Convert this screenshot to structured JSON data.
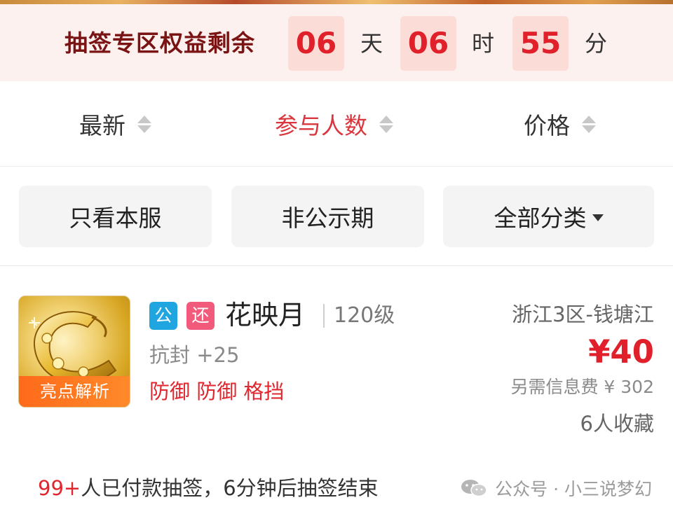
{
  "countdown": {
    "title": "抽签专区权益剩余",
    "days": "06",
    "days_unit": "天",
    "hours": "06",
    "hours_unit": "时",
    "minutes": "55",
    "minutes_unit": "分"
  },
  "sort": {
    "items": [
      {
        "label": "最新",
        "active": false
      },
      {
        "label": "参与人数",
        "active": true
      },
      {
        "label": "价格",
        "active": false
      }
    ]
  },
  "filters": {
    "items": [
      {
        "label": "只看本服"
      },
      {
        "label": "非公示期"
      },
      {
        "label": "全部分类"
      }
    ]
  },
  "listing": {
    "thumb_tag": "亮点解析",
    "badge_public": "公",
    "badge_return": "还",
    "name": "花映月",
    "level": "120级",
    "stat": "抗封 +25",
    "traits": "防御 防御 格挡",
    "server": "浙江3区-钱塘江",
    "price": "¥40",
    "fee": "另需信息费 ¥ 302",
    "favorites": "6人收藏"
  },
  "footer": {
    "count": "99+",
    "text": "人已付款抽签，6分钟后抽签结束"
  },
  "watermark": {
    "text": "公众号 · 小三说梦幻"
  },
  "colors": {
    "accent_red": "#e0202a",
    "banner_bg": "#fdf1ef",
    "badge_blue": "#1fa6e0",
    "badge_pink": "#f25a7c",
    "tag_orange": "#ff6a1a"
  }
}
